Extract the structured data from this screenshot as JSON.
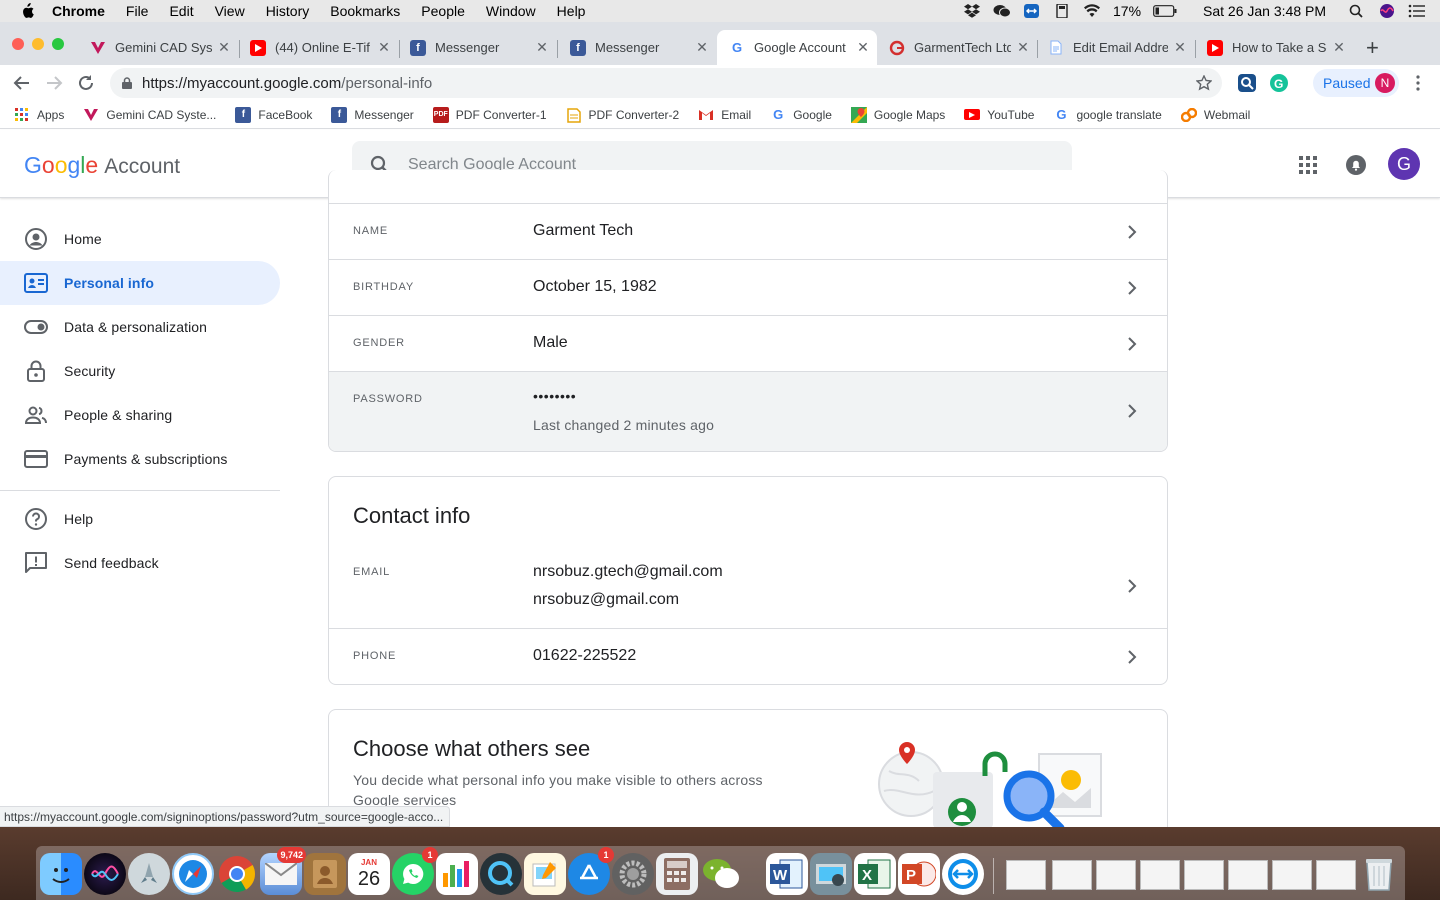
{
  "menubar": {
    "app": "Chrome",
    "items": [
      "File",
      "Edit",
      "View",
      "History",
      "Bookmarks",
      "People",
      "Window",
      "Help"
    ],
    "battery": "17%",
    "clock": "Sat 26 Jan  3:48 PM"
  },
  "tabs": [
    {
      "title": "Gemini CAD Syst",
      "icon": "gemini-icon"
    },
    {
      "title": "(44) Online E-Tif",
      "icon": "youtube-icon"
    },
    {
      "title": "Messenger",
      "icon": "facebook-icon"
    },
    {
      "title": "Messenger",
      "icon": "facebook-icon"
    },
    {
      "title": "Google Account",
      "icon": "google-icon"
    },
    {
      "title": "GarmentTech Ltd",
      "icon": "garmenttech-icon"
    },
    {
      "title": "Edit Email Addre",
      "icon": "document-icon"
    },
    {
      "title": "How to Take a Sc",
      "icon": "youtube-icon"
    }
  ],
  "address": {
    "host": "https://myaccount.google.com",
    "path": "/personal-info"
  },
  "profile": {
    "paused_label": "Paused",
    "initial": "N"
  },
  "bookmarks": [
    {
      "label": "Apps",
      "icon": "apps-grid-icon"
    },
    {
      "label": "Gemini CAD Syste...",
      "icon": "gemini-icon"
    },
    {
      "label": "FaceBook",
      "icon": "facebook-icon"
    },
    {
      "label": "Messenger",
      "icon": "facebook-icon"
    },
    {
      "label": "PDF Converter-1",
      "icon": "pdf-icon"
    },
    {
      "label": "PDF Converter-2",
      "icon": "pdf-doc-icon"
    },
    {
      "label": "Email",
      "icon": "gmail-icon"
    },
    {
      "label": "Google",
      "icon": "google-icon"
    },
    {
      "label": "Google Maps",
      "icon": "maps-icon"
    },
    {
      "label": "YouTube",
      "icon": "youtube-icon"
    },
    {
      "label": "google translate",
      "icon": "google-icon"
    },
    {
      "label": "Webmail",
      "icon": "webmail-icon"
    }
  ],
  "header": {
    "logo_letters": [
      "G",
      "o",
      "o",
      "g",
      "l",
      "e"
    ],
    "logo_suffix": "Account",
    "search_placeholder": "Search Google Account",
    "avatar_initial": "G"
  },
  "sidebar": {
    "items": [
      {
        "label": "Home",
        "icon": "account-circle-icon"
      },
      {
        "label": "Personal info",
        "icon": "id-card-icon"
      },
      {
        "label": "Data & personalization",
        "icon": "toggle-icon"
      },
      {
        "label": "Security",
        "icon": "lock-icon"
      },
      {
        "label": "People & sharing",
        "icon": "people-icon"
      },
      {
        "label": "Payments & subscriptions",
        "icon": "credit-card-icon"
      }
    ],
    "secondary": [
      {
        "label": "Help",
        "icon": "help-icon"
      },
      {
        "label": "Send feedback",
        "icon": "feedback-icon"
      }
    ]
  },
  "basic_info": {
    "rows": [
      {
        "label": "NAME",
        "value": "Garment Tech"
      },
      {
        "label": "BIRTHDAY",
        "value": "October 15, 1982"
      },
      {
        "label": "GENDER",
        "value": "Male"
      },
      {
        "label": "PASSWORD",
        "value": "••••••••",
        "sub": "Last changed 2 minutes ago"
      }
    ]
  },
  "contact_info": {
    "title": "Contact info",
    "email_label": "EMAIL",
    "emails": [
      "nrsobuz.gtech@gmail.com",
      "nrsobuz@gmail.com"
    ],
    "phone_label": "PHONE",
    "phone": "01622-225522"
  },
  "others_see": {
    "title": "Choose what others see",
    "description": "You decide what personal info you make visible to others across Google services"
  },
  "status_url": "https://myaccount.google.com/signinoptions/password?utm_source=google-acco...",
  "dock": {
    "calendar_month": "JAN",
    "calendar_day": "26",
    "mail_badge": "9,742",
    "whatsapp_badge": "1",
    "appstore_badge": "1"
  }
}
